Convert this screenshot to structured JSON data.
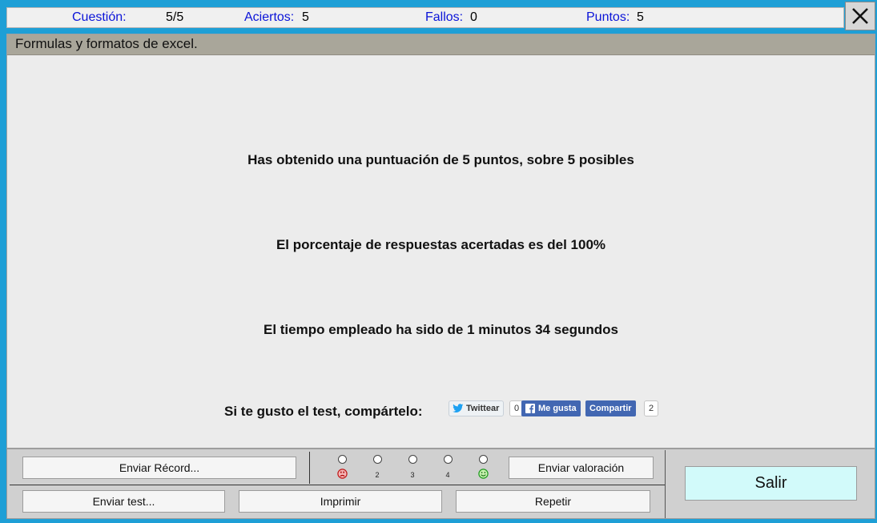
{
  "stats": {
    "cuestion_label": "Cuestión:",
    "cuestion_value": "5/5",
    "aciertos_label": "Aciertos:",
    "aciertos_value": "5",
    "fallos_label": "Fallos:",
    "fallos_value": "0",
    "puntos_label": "Puntos:",
    "puntos_value": "5"
  },
  "close_icon": "close-icon",
  "title": "Formulas y formatos de excel.",
  "results": {
    "score_line": "Has obtenido una puntuación de 5 puntos, sobre 5 posibles",
    "percent_line": "El porcentaje de respuestas acertadas es del 100%",
    "time_line": "El tiempo empleado ha sido de 1 minutos 34 segundos"
  },
  "share": {
    "label": "Si te gusto el test, compártelo:",
    "twitter_label": "Twittear",
    "twitter_count": "0",
    "like_label": "Me gusta",
    "share_label": "Compartir",
    "share_count": "2"
  },
  "buttons": {
    "send_record": "Enviar Récord...",
    "send_rating": "Enviar valoración",
    "send_test": "Enviar test...",
    "print": "Imprimir",
    "repeat": "Repetir",
    "exit": "Salir"
  },
  "rating": {
    "labels": [
      "2",
      "3",
      "4"
    ],
    "low_icon": "sad-face-icon",
    "high_icon": "happy-face-icon"
  },
  "colors": {
    "background": "#1e9fd6",
    "stat_label": "#0b14d8",
    "title_bar": "#a9a69a",
    "exit_button": "#d2fafa",
    "facebook": "#4267b2"
  }
}
